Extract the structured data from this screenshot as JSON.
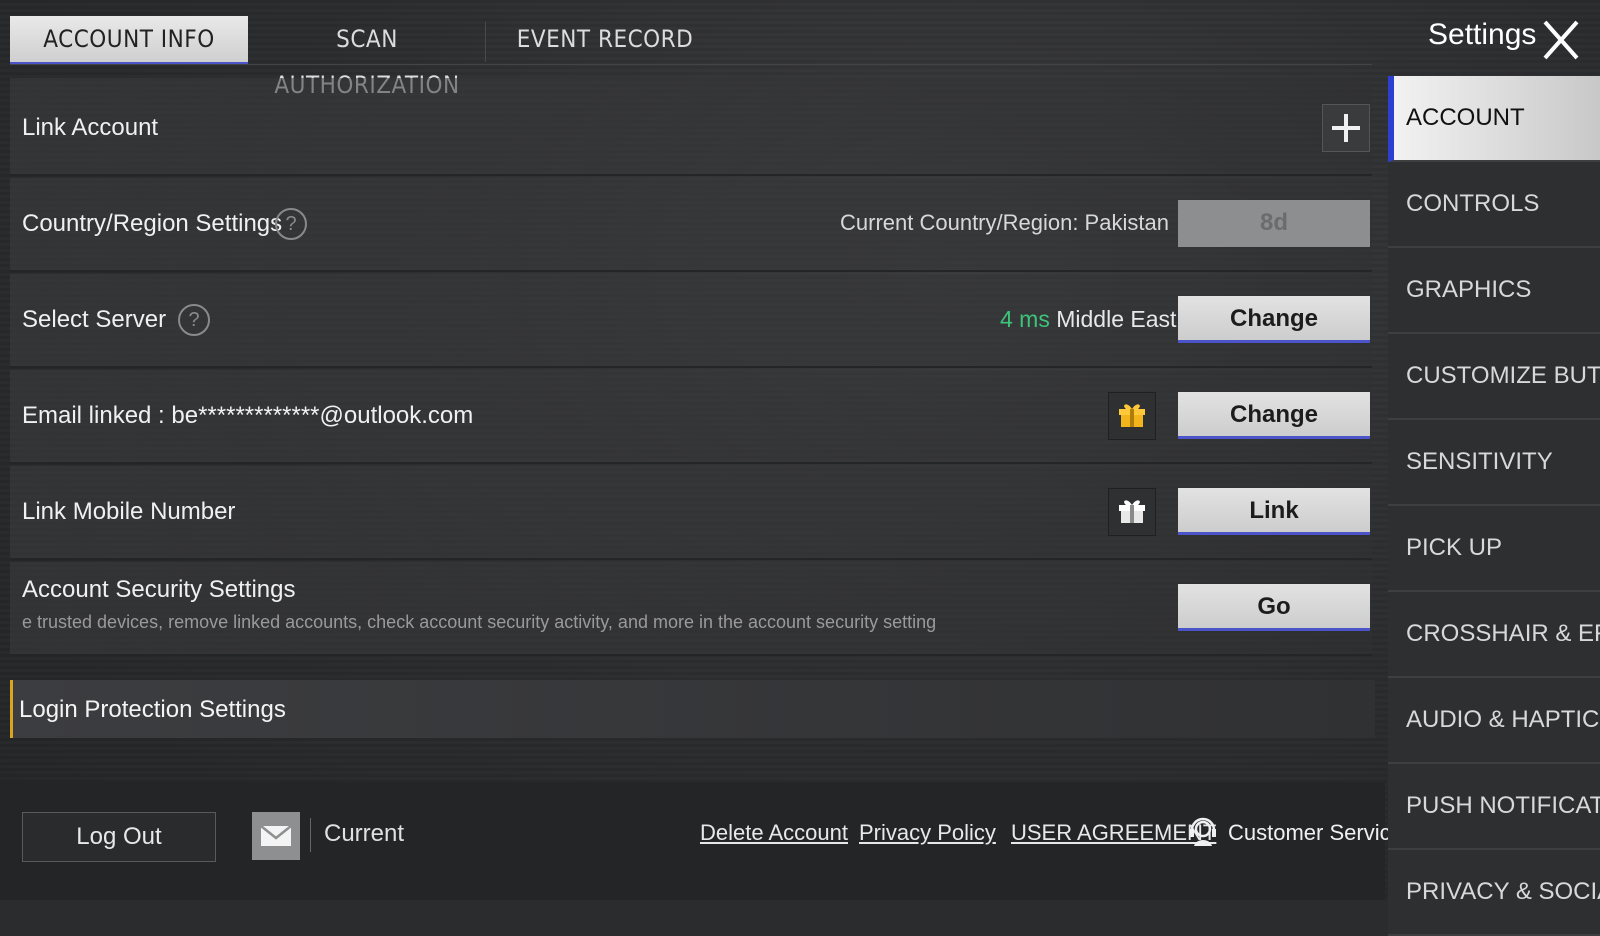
{
  "tabs": [
    {
      "label": "ACCOUNT INFO",
      "active": true
    },
    {
      "label": "SCAN AUTHORIZATION",
      "active": false
    },
    {
      "label": "EVENT RECORD",
      "active": false
    }
  ],
  "header": {
    "title": "Settings",
    "close_icon": "close-icon"
  },
  "rows": {
    "link_account": {
      "label": "Link Account",
      "icon": "plus-icon"
    },
    "country": {
      "label": "Country/Region Settings",
      "help": "?",
      "current": "Current Country/Region: Pakistan",
      "button": "8d"
    },
    "server": {
      "label": "Select Server",
      "help": "?",
      "ping": "4 ms",
      "region": "Middle East",
      "button": "Change"
    },
    "email": {
      "label": "Email linked : be*************@outlook.com",
      "icon": "gift-icon",
      "button": "Change"
    },
    "mobile": {
      "label": "Link Mobile Number",
      "icon": "gift-icon",
      "button": "Link"
    },
    "security": {
      "label": "Account Security Settings",
      "description": "e trusted devices, remove linked accounts, check account security activity, and more in the account security setting",
      "button": "Go"
    }
  },
  "section": {
    "label": "Login Protection Settings"
  },
  "bottom": {
    "logout": "Log Out",
    "mail_icon": "mail-icon",
    "current": "Current",
    "delete_account": "Delete Account",
    "privacy_policy": "Privacy Policy",
    "user_agreement": "USER AGREEMENT",
    "customer_service": "Customer Service",
    "customer_service_icon": "headset-icon"
  },
  "sidebar": {
    "items": [
      {
        "label": "ACCOUNT",
        "active": true
      },
      {
        "label": "CONTROLS"
      },
      {
        "label": "GRAPHICS"
      },
      {
        "label": "CUSTOMIZE BUTTONS"
      },
      {
        "label": "SENSITIVITY"
      },
      {
        "label": "PICK UP"
      },
      {
        "label": "CROSSHAIR & EFFECT"
      },
      {
        "label": "AUDIO & HAPTICS"
      },
      {
        "label": "PUSH NOTIFICATIONS"
      },
      {
        "label": "PRIVACY & SOCIAL"
      }
    ]
  },
  "colors": {
    "accent": "#4b55c8",
    "ping_green": "#3cc47a",
    "section_bar": "#d9a520"
  }
}
